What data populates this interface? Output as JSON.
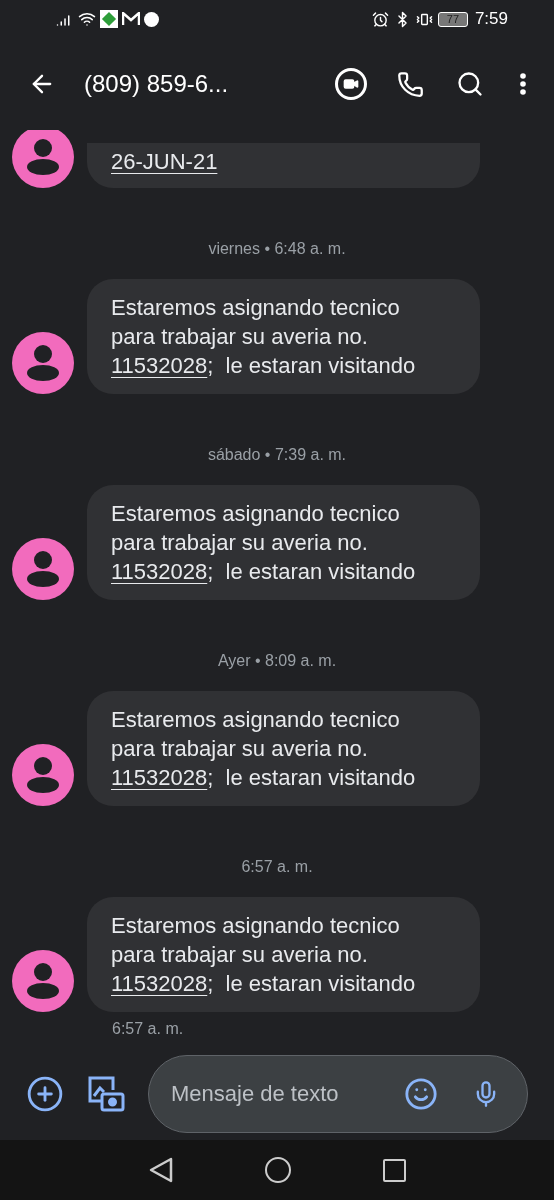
{
  "status_bar": {
    "time": "7:59",
    "battery": "77"
  },
  "header": {
    "title": "(809) 859-6..."
  },
  "first_message": {
    "lines": [
      [
        {
          "text": "26-JUN-21",
          "link": true
        }
      ]
    ]
  },
  "conversation": [
    {
      "timestamp": "viernes • 6:48 a. m.",
      "lines": [
        [
          {
            "text": "Estaremos asignando tecnico",
            "link": false
          }
        ],
        [
          {
            "text": "para trabajar su averia no.",
            "link": false
          }
        ],
        [
          {
            "text": "11532028",
            "link": true
          },
          {
            "text": ";  le estaran visitando",
            "link": false
          }
        ]
      ]
    },
    {
      "timestamp": "sábado • 7:39 a. m.",
      "lines": [
        [
          {
            "text": "Estaremos asignando tecnico",
            "link": false
          }
        ],
        [
          {
            "text": "para trabajar su averia no.",
            "link": false
          }
        ],
        [
          {
            "text": "11532028",
            "link": true
          },
          {
            "text": ";  le estaran visitando",
            "link": false
          }
        ]
      ]
    },
    {
      "timestamp": "Ayer • 8:09 a. m.",
      "lines": [
        [
          {
            "text": "Estaremos asignando tecnico",
            "link": false
          }
        ],
        [
          {
            "text": "para trabajar su averia no.",
            "link": false
          }
        ],
        [
          {
            "text": "11532028",
            "link": true
          },
          {
            "text": ";  le estaran visitando",
            "link": false
          }
        ]
      ]
    },
    {
      "timestamp": "6:57 a. m.",
      "lines": [
        [
          {
            "text": "Estaremos asignando tecnico",
            "link": false
          }
        ],
        [
          {
            "text": "para trabajar su averia no.",
            "link": false
          }
        ],
        [
          {
            "text": "11532028",
            "link": true
          },
          {
            "text": ";  le estaran visitando",
            "link": false
          }
        ]
      ]
    }
  ],
  "last_message_time": "6:57 a. m.",
  "composer": {
    "placeholder": "Mensaje de texto"
  }
}
